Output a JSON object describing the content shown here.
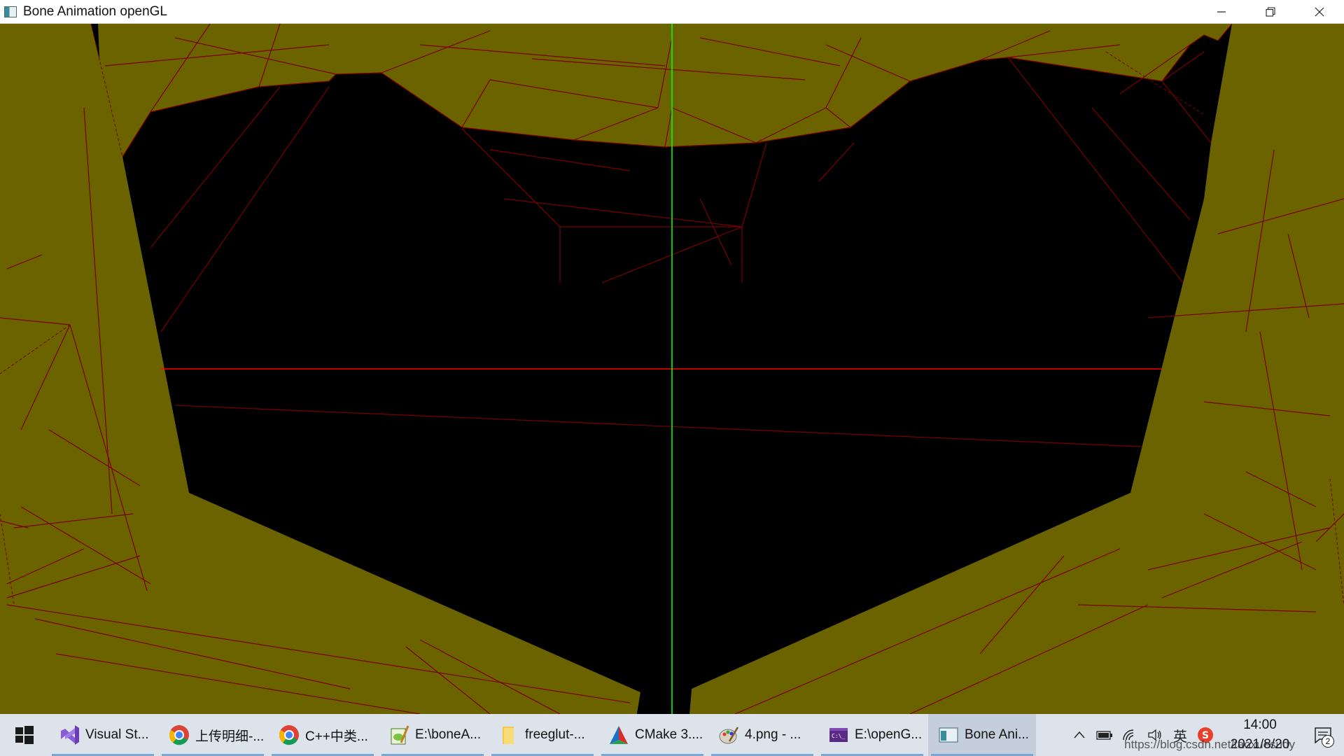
{
  "window": {
    "title": "Bone Animation openGL",
    "minimize_icon": "minimize-icon",
    "restore_icon": "restore-icon",
    "close_icon": "close-icon"
  },
  "scene": {
    "background_color": "#000000",
    "mesh_fill_color": "#6b6300",
    "wireframe_color": "#7a0000",
    "x_axis_color": "#ff0000",
    "y_axis_color": "#00ff00"
  },
  "taskbar": {
    "start_icon": "windows-icon",
    "items": [
      {
        "icon": "visual-studio-icon",
        "label": "Visual St..."
      },
      {
        "icon": "chrome-icon",
        "label": "上传明细-..."
      },
      {
        "icon": "chrome-icon",
        "label": "C++中类..."
      },
      {
        "icon": "notepad-plus-icon",
        "label": "E:\\boneA..."
      },
      {
        "icon": "folder-icon",
        "label": "freeglut-..."
      },
      {
        "icon": "cmake-icon",
        "label": "CMake 3...."
      },
      {
        "icon": "paint-icon",
        "label": "4.png - ..."
      },
      {
        "icon": "console-icon",
        "label": "E:\\openG..."
      },
      {
        "icon": "opengl-window-icon",
        "label": "Bone Ani..."
      }
    ],
    "tray": {
      "ime_label": "英",
      "time": "14:00",
      "date": "2021/8/20",
      "watermark": "https://blog.csdn.net/taoxuesudy",
      "notification_count": "2"
    }
  }
}
